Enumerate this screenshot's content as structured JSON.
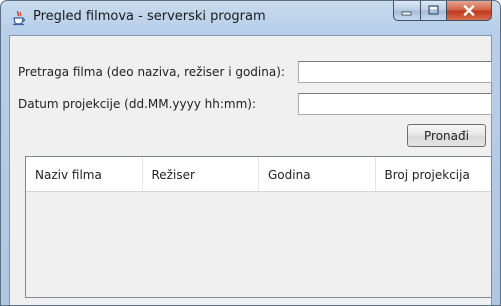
{
  "window": {
    "title": "Pregled filmova - serverski program",
    "icon": "java-coffee-cup-icon",
    "caption_buttons": [
      "minimize-icon",
      "maximize-icon",
      "close-icon"
    ],
    "close_color": "#c1391d"
  },
  "search": {
    "film_label": "Pretraga filma (deo naziva, režiser i godina):",
    "film_value": "",
    "date_label": "Datum projekcije (dd.MM.yyyy hh:mm):",
    "date_value": "",
    "find_button": "Pronađi"
  },
  "table": {
    "columns": [
      "Naziv filma",
      "Režiser",
      "Godina",
      "Broj projekcija"
    ],
    "rows": []
  }
}
